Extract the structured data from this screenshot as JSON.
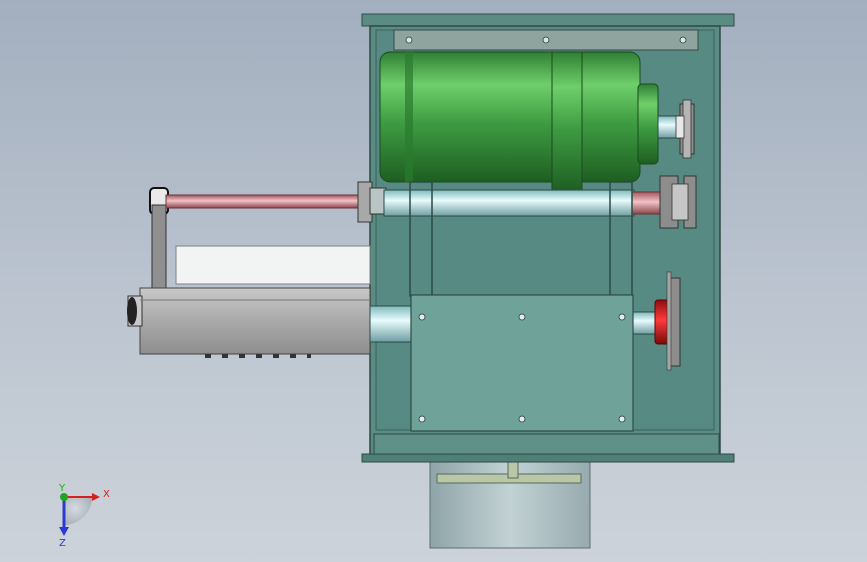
{
  "triad": {
    "x_label": "X",
    "y_label": "Y",
    "z_label": "Z"
  },
  "colors": {
    "background_top": "#a3afbf",
    "background_bottom": "#cdd3da",
    "housing": "#5a8c84",
    "housing_inner": "#4f7f77",
    "motor_green": "#3e9b42",
    "motor_highlight": "#6fcf6a",
    "shaft_teal": "#bfe6e8",
    "shaft_red": "#d79aa0",
    "collar_red": "#d01c1c",
    "plate": "#6fa39a",
    "base_block": "#a9bcbf",
    "axis_x": "#d42020",
    "axis_y": "#1fa51f",
    "axis_z": "#2b3bd0"
  }
}
